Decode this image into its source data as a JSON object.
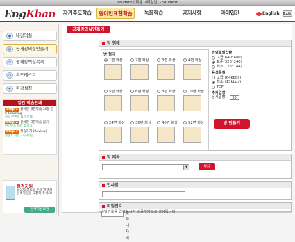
{
  "window": {
    "title": "studentㅣ학생1(테일인) - Student"
  },
  "logo": {
    "text_a": "Eng",
    "text_b": "Khan"
  },
  "nav": {
    "items": [
      "자기주도학습",
      "원어민표현학습",
      "녹화학습",
      "공지사항",
      "마이입간"
    ],
    "active_index": 1,
    "language": "English",
    "exit": "Exit"
  },
  "sidebar": {
    "items": [
      {
        "label": "내강의실",
        "icon": "person-icon"
      },
      {
        "label": "공개강의실만들기",
        "icon": "board-icon"
      },
      {
        "label": "공개강의실목록",
        "icon": "list-icon"
      },
      {
        "label": "속도테스트",
        "icon": "speed-icon"
      },
      {
        "label": "환경설정",
        "icon": "gear-icon"
      }
    ],
    "selected_index": 1
  },
  "study_plan": {
    "title": "잉칸 학습안내",
    "steps": [
      {
        "num": "Step 1",
        "text": "원어민 표현학습 30분 전 C-Learning",
        "sub": "학습 콘텐츠 표기 안내"
      },
      {
        "num": "Step 2",
        "text": "원어민 표현학습 참가",
        "sub": "원어민과 발화 및 참가"
      },
      {
        "num": "Step 3",
        "text": "복습하기 (Review)",
        "sub": "콘텐츠 학습 · 녹화학습"
      }
    ]
  },
  "help": {
    "title": "원격지원",
    "desc": "화상/음성회의 문제 발생시 원격지원을 요청해 주세요!",
    "button": "원격지원요청"
  },
  "page_title": "공개강의실만들기",
  "layout_section": {
    "header": "방 형태",
    "caption": "방 형태",
    "options": [
      "1면 화상",
      "2면 화상",
      "3면 화상",
      "4면 화상",
      "5면 화상",
      "6면 화상",
      "8면 화상",
      "10면 화상",
      "24면 화상",
      "36면 화상",
      "40면 화상",
      "52면 화상"
    ],
    "selected_index": 0
  },
  "settings": {
    "quality_label": "방영호필압출",
    "quality_options": [
      "고급(640*480)",
      "표준(320*240)",
      "최소(176*144)"
    ],
    "quality_selected": 1,
    "audio_label": "음성품질",
    "audio_options": [
      "고급",
      "최소",
      "TCP"
    ],
    "audio_rates": [
      "(64kbps)",
      "(13kbps)",
      ""
    ],
    "audio_selected": 1,
    "extra_label": "추가입장",
    "capacity_label": "동시입장",
    "capacity_value": "50",
    "create_button": "방 만들기"
  },
  "subject_section": {
    "header": "방 제목",
    "delete_button": "삭제"
  },
  "greeting_section": {
    "header": "인사말"
  },
  "password_section": {
    "header": "비밀번호",
    "suffix_label": "숫자네 자리",
    "hint": "비밀번호를 입력하시면 비공개방으로 생성됩니다."
  }
}
